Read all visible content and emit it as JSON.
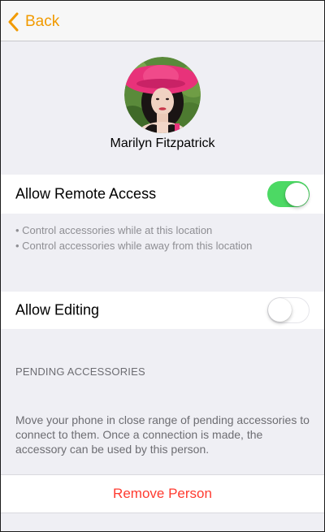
{
  "nav": {
    "back_label": "Back",
    "back_icon": "chevron-left-icon"
  },
  "person": {
    "name": "Marilyn Fitzpatrick"
  },
  "remote_access": {
    "label": "Allow Remote Access",
    "enabled": true,
    "bullets": [
      "Control accessories while at this location",
      "Control accessories while away from this location"
    ]
  },
  "editing": {
    "label": "Allow Editing",
    "enabled": false
  },
  "pending": {
    "header": "PENDING ACCESSORIES",
    "description": "Move your phone in close range of pending accessories to connect to them. Once a connection is made, the accessory can be used by this person."
  },
  "actions": {
    "remove_label": "Remove Person"
  },
  "colors": {
    "accent": "#f19a00",
    "toggle_on": "#4cd964",
    "destructive": "#ff3b30",
    "background": "#efeff4"
  }
}
